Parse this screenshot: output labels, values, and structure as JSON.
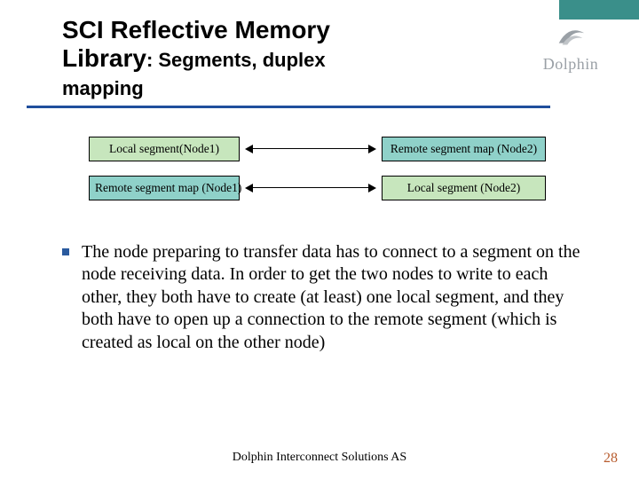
{
  "corner_color": "#3a8f8a",
  "logo": {
    "text": "Dolphin"
  },
  "title": {
    "line1": "SCI Reflective Memory",
    "line2a": "Library",
    "line2b": ": Segments, duplex",
    "line3": "mapping"
  },
  "diagram": {
    "box_a": "Local segment(Node1)",
    "box_b": "Remote segment map (Node1)",
    "box_c": "Remote segment map (Node2)",
    "box_d": "Local segment (Node2)"
  },
  "body": {
    "text": "The node preparing to transfer data has to connect to a segment on the node receiving data. In order to get the two nodes to write to each other, they both have to create (at least) one local segment, and they both have to open up a connection to the remote segment (which is created as local on the other node)"
  },
  "footer": "Dolphin Interconnect Solutions AS",
  "page": "28"
}
